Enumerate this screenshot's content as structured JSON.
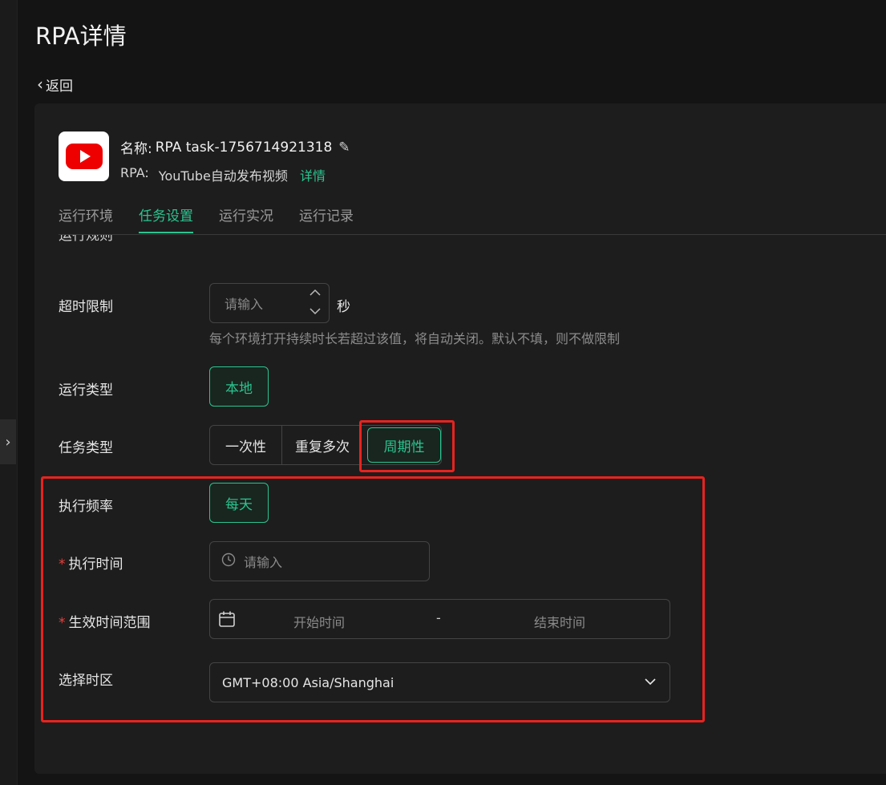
{
  "page": {
    "title": "RPA详情",
    "back_label": "返回",
    "collapse_glyph": "›",
    "back_glyph": "‹"
  },
  "task": {
    "name_label": "名称:",
    "name": "RPA task-1756714921318",
    "rpa_label": "RPA:",
    "rpa_name": "YouTube自动发布视频",
    "detail_link": "详情"
  },
  "tabs": [
    {
      "label": "运行环境",
      "active": false
    },
    {
      "label": "任务设置",
      "active": true
    },
    {
      "label": "运行实况",
      "active": false
    },
    {
      "label": "运行记录",
      "active": false
    }
  ],
  "form": {
    "section_partial": "运行规则",
    "timeout": {
      "label": "超时限制",
      "placeholder": "请输入",
      "unit": "秒",
      "hint": "每个环境打开持续时长若超过该值，将自动关闭。默认不填，则不做限制"
    },
    "run_type": {
      "label": "运行类型",
      "value": "本地"
    },
    "task_type": {
      "label": "任务类型",
      "options": [
        "一次性",
        "重复多次",
        "周期性"
      ],
      "selected": "周期性"
    },
    "frequency": {
      "label": "执行频率",
      "value": "每天"
    },
    "exec_time": {
      "label": "执行时间",
      "placeholder": "请输入",
      "required": "*"
    },
    "effective_range": {
      "label": "生效时间范围",
      "start_placeholder": "开始时间",
      "separator": "-",
      "end_placeholder": "结束时间",
      "required": "*"
    },
    "timezone": {
      "label": "选择时区",
      "value": "GMT+08:00 Asia/Shanghai"
    }
  },
  "colors": {
    "accent": "#2bc490",
    "highlight": "#e8231f",
    "required": "#e5413c"
  },
  "icons": [
    "chevron-right-icon",
    "chevron-left-icon",
    "youtube-icon",
    "pencil-icon",
    "chevron-up-icon",
    "chevron-down-icon",
    "clock-icon",
    "calendar-icon"
  ]
}
